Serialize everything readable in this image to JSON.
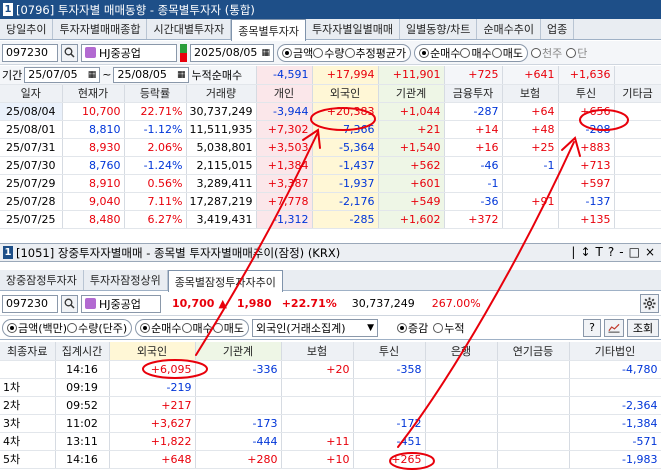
{
  "top_window": {
    "number": "1",
    "title": "[0796] 투자자별 매매동향 - 종목별투자자 (통합)",
    "tabs": [
      "당일추이",
      "투자자별매매종합",
      "시간대별투자자",
      "종목별투자자",
      "투자자별일별매매",
      "일별동향/차트",
      "순매수추이",
      "업종"
    ],
    "active_tab_index": 3,
    "code": "097230",
    "stock_name": "HJ중공업",
    "date": "2025/08/05",
    "radio_amount_labels": [
      "금액",
      "수량",
      "추정평균가"
    ],
    "radio_amount_selected": 0,
    "radio_trade_labels": [
      "순매수",
      "매수",
      "매도"
    ],
    "radio_trade_selected": 0,
    "radio_extra_labels": [
      "천주",
      "단"
    ],
    "period_label": "기간",
    "period_from": "25/07/05",
    "period_sep": "~",
    "period_to": "25/08/05",
    "cumulative_label": "누적순매수",
    "cumulative_values": [
      "-4,591",
      "+17,994",
      "+11,901",
      "+725",
      "+641",
      "+1,636"
    ],
    "columns": [
      "일자",
      "현재가",
      "등락률",
      "거래량",
      "개인",
      "외국인",
      "기관계",
      "금융투자",
      "보험",
      "투신",
      "기타금"
    ],
    "rows": [
      {
        "date": "25/08/04",
        "price": "10,700",
        "rate": "22.71%",
        "volume": "30,737,249",
        "indiv": "-3,944",
        "foreign": "+20,383",
        "inst": "+1,044",
        "fin": "-287",
        "ins": "+64",
        "trust": "+656"
      },
      {
        "date": "25/08/01",
        "price": "8,810",
        "rate": "-1.12%",
        "volume": "11,511,935",
        "indiv": "+7,302",
        "foreign": "-7,366",
        "inst": "+21",
        "fin": "+14",
        "ins": "+48",
        "trust": "-208"
      },
      {
        "date": "25/07/31",
        "price": "8,930",
        "rate": "2.06%",
        "volume": "5,038,801",
        "indiv": "+3,503",
        "foreign": "-5,364",
        "inst": "+1,540",
        "fin": "+16",
        "ins": "+25",
        "trust": "+883"
      },
      {
        "date": "25/07/30",
        "price": "8,760",
        "rate": "-1.24%",
        "volume": "2,115,015",
        "indiv": "+1,384",
        "foreign": "-1,437",
        "inst": "+562",
        "fin": "-46",
        "ins": "-1",
        "trust": "+713"
      },
      {
        "date": "25/07/29",
        "price": "8,910",
        "rate": "0.56%",
        "volume": "3,289,411",
        "indiv": "+3,387",
        "foreign": "-1,937",
        "inst": "+601",
        "fin": "-1",
        "ins": "",
        "trust": "+597"
      },
      {
        "date": "25/07/28",
        "price": "9,040",
        "rate": "7.11%",
        "volume": "17,287,219",
        "indiv": "+7,778",
        "foreign": "-2,176",
        "inst": "+549",
        "fin": "-36",
        "ins": "+91",
        "trust": "-137"
      },
      {
        "date": "25/07/25",
        "price": "8,480",
        "rate": "6.27%",
        "volume": "3,419,431",
        "indiv": "-1,312",
        "foreign": "-285",
        "inst": "+1,602",
        "fin": "+372",
        "ins": "",
        "trust": "+135"
      }
    ]
  },
  "bottom_window": {
    "number": "1",
    "title": "[1051] 장중투자자별매매 - 종목별 투자자별매매추이(잠정) (KRX)",
    "ctrl_icons": [
      "|",
      "↕",
      "T",
      "?",
      "-",
      "□",
      "×"
    ],
    "tabs": [
      "장중잠정투자자",
      "투자자잠정상위",
      "종목별잠정투자자추이"
    ],
    "active_tab_index": 2,
    "code": "097230",
    "stock_name": "HJ중공업",
    "price": "10,700",
    "arrow": "▲",
    "change": "1,980",
    "change_rate": "+22.71%",
    "volume": "30,737,249",
    "volume_pct": "267.00%",
    "radio_unit_labels": [
      "금액(백만)",
      "수량(단주)"
    ],
    "radio_unit_selected": 0,
    "radio_trade_labels": [
      "순매수",
      "매수",
      "매도"
    ],
    "radio_trade_selected": 0,
    "investor_select": "외국인(거래소집계)",
    "radio_mode_labels": [
      "증감",
      "누적"
    ],
    "radio_mode_selected": 0,
    "btn_help": "?",
    "btn_query": "조회",
    "columns": [
      "최종자료",
      "집계시간",
      "외국인",
      "기관계",
      "보험",
      "투신",
      "은행",
      "연기금등",
      "기타법인"
    ],
    "rows": [
      {
        "seq": "",
        "time": "14:16",
        "foreign": "+6,095",
        "inst": "-336",
        "ins": "+20",
        "trust": "-358",
        "bank": "",
        "pension": "",
        "etc": "-4,780"
      },
      {
        "seq": "1차",
        "time": "09:19",
        "foreign": "-219",
        "inst": "",
        "ins": "",
        "trust": "",
        "bank": "",
        "pension": "",
        "etc": ""
      },
      {
        "seq": "2차",
        "time": "09:52",
        "foreign": "+217",
        "inst": "",
        "ins": "",
        "trust": "",
        "bank": "",
        "pension": "",
        "etc": "-2,364"
      },
      {
        "seq": "3차",
        "time": "11:02",
        "foreign": "+3,627",
        "inst": "-173",
        "ins": "",
        "trust": "-172",
        "bank": "",
        "pension": "",
        "etc": "-1,384"
      },
      {
        "seq": "4차",
        "time": "13:11",
        "foreign": "+1,822",
        "inst": "-444",
        "ins": "+11",
        "trust": "-451",
        "bank": "",
        "pension": "",
        "etc": "-571"
      },
      {
        "seq": "5차",
        "time": "14:16",
        "foreign": "+648",
        "inst": "+280",
        "ins": "+10",
        "trust": "+265",
        "bank": "",
        "pension": "",
        "etc": "-1,983"
      }
    ]
  },
  "annotation_color": "#e8000b"
}
